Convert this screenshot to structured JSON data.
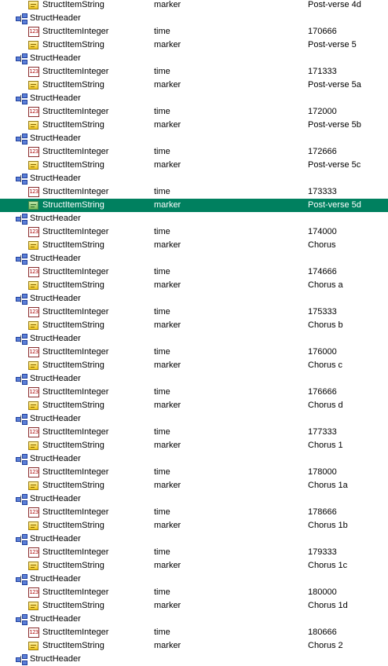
{
  "colors": {
    "selection_bg": "#00805f",
    "selection_text": "#ffffff"
  },
  "icons": {
    "header": "struct-header-icon",
    "integer": "integer-item-icon",
    "string": "string-item-icon"
  },
  "rows": [
    {
      "kind": "string",
      "label": "StructItemString",
      "name": "marker",
      "value": "Post-verse 4d"
    },
    {
      "kind": "header",
      "label": "StructHeader"
    },
    {
      "kind": "integer",
      "label": "StructItemInteger",
      "name": "time",
      "value": "170666"
    },
    {
      "kind": "string",
      "label": "StructItemString",
      "name": "marker",
      "value": "Post-verse 5"
    },
    {
      "kind": "header",
      "label": "StructHeader"
    },
    {
      "kind": "integer",
      "label": "StructItemInteger",
      "name": "time",
      "value": "171333"
    },
    {
      "kind": "string",
      "label": "StructItemString",
      "name": "marker",
      "value": "Post-verse 5a"
    },
    {
      "kind": "header",
      "label": "StructHeader"
    },
    {
      "kind": "integer",
      "label": "StructItemInteger",
      "name": "time",
      "value": "172000"
    },
    {
      "kind": "string",
      "label": "StructItemString",
      "name": "marker",
      "value": "Post-verse 5b"
    },
    {
      "kind": "header",
      "label": "StructHeader"
    },
    {
      "kind": "integer",
      "label": "StructItemInteger",
      "name": "time",
      "value": "172666"
    },
    {
      "kind": "string",
      "label": "StructItemString",
      "name": "marker",
      "value": "Post-verse 5c"
    },
    {
      "kind": "header",
      "label": "StructHeader"
    },
    {
      "kind": "integer",
      "label": "StructItemInteger",
      "name": "time",
      "value": "173333"
    },
    {
      "kind": "string",
      "label": "StructItemString",
      "name": "marker",
      "value": "Post-verse 5d",
      "selected": true
    },
    {
      "kind": "header",
      "label": "StructHeader"
    },
    {
      "kind": "integer",
      "label": "StructItemInteger",
      "name": "time",
      "value": "174000"
    },
    {
      "kind": "string",
      "label": "StructItemString",
      "name": "marker",
      "value": "Chorus"
    },
    {
      "kind": "header",
      "label": "StructHeader"
    },
    {
      "kind": "integer",
      "label": "StructItemInteger",
      "name": "time",
      "value": "174666"
    },
    {
      "kind": "string",
      "label": "StructItemString",
      "name": "marker",
      "value": "Chorus a"
    },
    {
      "kind": "header",
      "label": "StructHeader"
    },
    {
      "kind": "integer",
      "label": "StructItemInteger",
      "name": "time",
      "value": "175333"
    },
    {
      "kind": "string",
      "label": "StructItemString",
      "name": "marker",
      "value": "Chorus b"
    },
    {
      "kind": "header",
      "label": "StructHeader"
    },
    {
      "kind": "integer",
      "label": "StructItemInteger",
      "name": "time",
      "value": "176000"
    },
    {
      "kind": "string",
      "label": "StructItemString",
      "name": "marker",
      "value": "Chorus c"
    },
    {
      "kind": "header",
      "label": "StructHeader"
    },
    {
      "kind": "integer",
      "label": "StructItemInteger",
      "name": "time",
      "value": "176666"
    },
    {
      "kind": "string",
      "label": "StructItemString",
      "name": "marker",
      "value": "Chorus d"
    },
    {
      "kind": "header",
      "label": "StructHeader"
    },
    {
      "kind": "integer",
      "label": "StructItemInteger",
      "name": "time",
      "value": "177333"
    },
    {
      "kind": "string",
      "label": "StructItemString",
      "name": "marker",
      "value": "Chorus 1"
    },
    {
      "kind": "header",
      "label": "StructHeader"
    },
    {
      "kind": "integer",
      "label": "StructItemInteger",
      "name": "time",
      "value": "178000"
    },
    {
      "kind": "string",
      "label": "StructItemString",
      "name": "marker",
      "value": "Chorus 1a"
    },
    {
      "kind": "header",
      "label": "StructHeader"
    },
    {
      "kind": "integer",
      "label": "StructItemInteger",
      "name": "time",
      "value": "178666"
    },
    {
      "kind": "string",
      "label": "StructItemString",
      "name": "marker",
      "value": "Chorus 1b"
    },
    {
      "kind": "header",
      "label": "StructHeader"
    },
    {
      "kind": "integer",
      "label": "StructItemInteger",
      "name": "time",
      "value": "179333"
    },
    {
      "kind": "string",
      "label": "StructItemString",
      "name": "marker",
      "value": "Chorus 1c"
    },
    {
      "kind": "header",
      "label": "StructHeader"
    },
    {
      "kind": "integer",
      "label": "StructItemInteger",
      "name": "time",
      "value": "180000"
    },
    {
      "kind": "string",
      "label": "StructItemString",
      "name": "marker",
      "value": "Chorus 1d"
    },
    {
      "kind": "header",
      "label": "StructHeader"
    },
    {
      "kind": "integer",
      "label": "StructItemInteger",
      "name": "time",
      "value": "180666"
    },
    {
      "kind": "string",
      "label": "StructItemString",
      "name": "marker",
      "value": "Chorus 2"
    },
    {
      "kind": "header",
      "label": "StructHeader"
    }
  ]
}
